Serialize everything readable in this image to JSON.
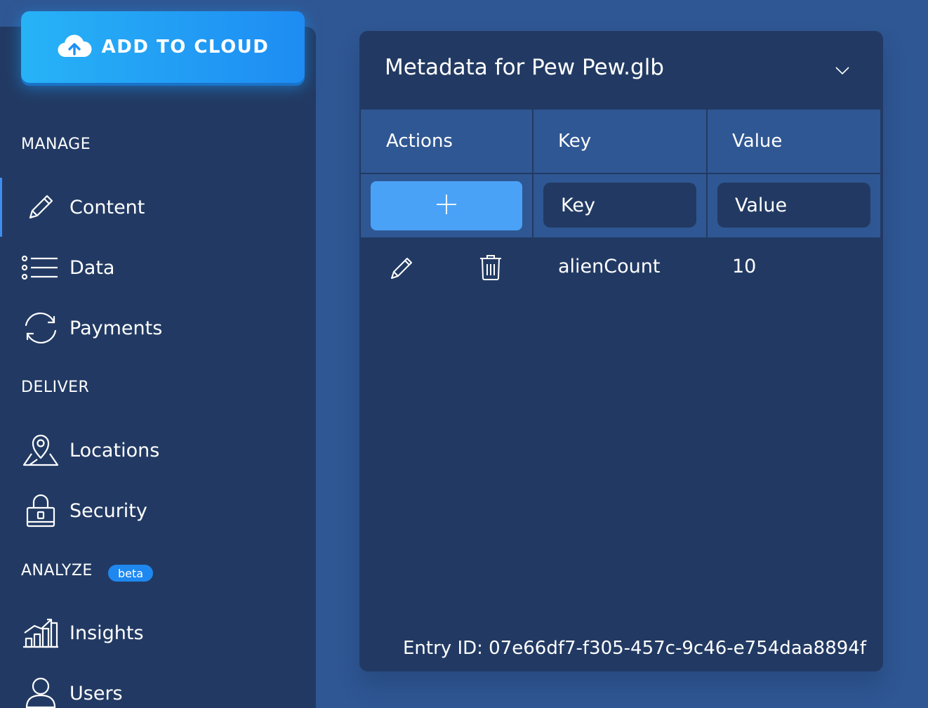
{
  "sidebar": {
    "add_button_label": "ADD TO CLOUD",
    "sections": {
      "manage": "MANAGE",
      "deliver": "DELIVER",
      "analyze": "ANALYZE",
      "analyze_badge": "beta"
    },
    "items": [
      {
        "label": "Content",
        "icon": "pencil-icon",
        "active": true
      },
      {
        "label": "Data",
        "icon": "list-icon"
      },
      {
        "label": "Payments",
        "icon": "sync-icon"
      },
      {
        "label": "Locations",
        "icon": "map-pin-icon"
      },
      {
        "label": "Security",
        "icon": "lock-icon"
      },
      {
        "label": "Insights",
        "icon": "bar-chart-icon"
      },
      {
        "label": "Users",
        "icon": "user-icon"
      }
    ]
  },
  "panel": {
    "title": "Metadata for Pew Pew.glb",
    "columns": [
      "Actions",
      "Key",
      "Value"
    ],
    "inputs": {
      "key_placeholder": "Key",
      "value_placeholder": "Value"
    },
    "rows": [
      {
        "key": "alienCount",
        "value": "10"
      }
    ],
    "entry_id": "Entry ID: 07e66df7-f305-457c-9c46-e754daa8894f"
  },
  "colors": {
    "background": "#2f5793",
    "sidebar": "#223a63",
    "panel": "#223a63",
    "accent": "#1e88f0",
    "add_row_button": "#4aa2f7"
  }
}
